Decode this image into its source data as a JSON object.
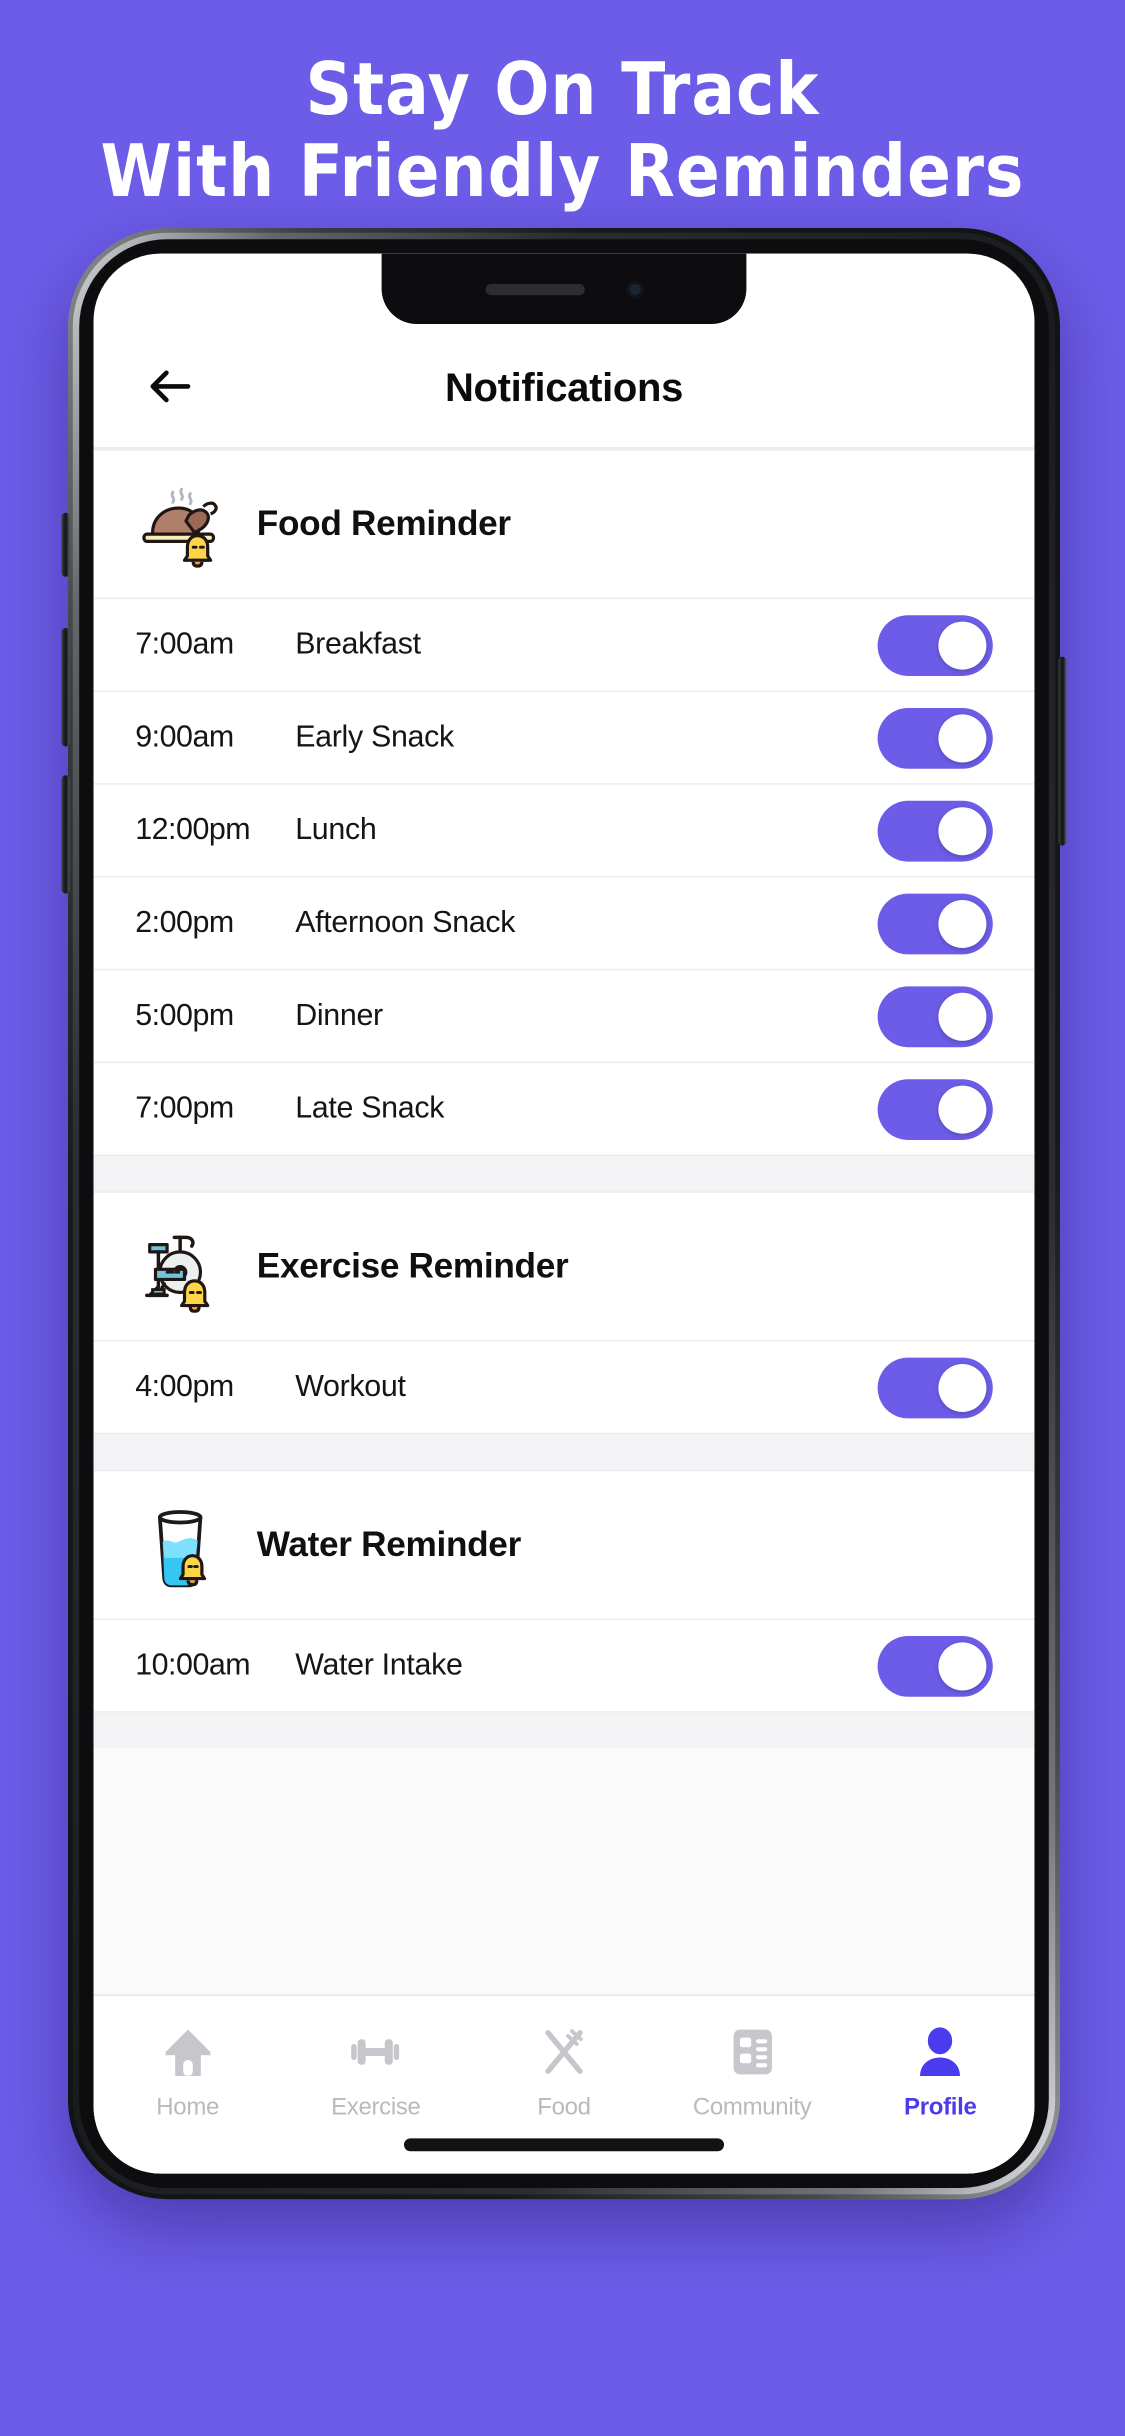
{
  "promo": {
    "headline_line1": "Stay On Track",
    "headline_line2": "With Friendly Reminders",
    "background_color": "#6C5CE7",
    "headline_color": "#FFFFFF"
  },
  "app": {
    "header": {
      "back_icon": "arrow-left-icon",
      "title": "Notifications"
    },
    "accent_color": "#6C5CE7",
    "active_tab_color": "#4B3BEF",
    "sections": [
      {
        "icon": "roast-meat-with-bell-icon",
        "title": "Food Reminder",
        "rows": [
          {
            "time": "7:00am",
            "label": "Breakfast",
            "enabled": true
          },
          {
            "time": "9:00am",
            "label": "Early Snack",
            "enabled": true
          },
          {
            "time": "12:00pm",
            "label": "Lunch",
            "enabled": true
          },
          {
            "time": "2:00pm",
            "label": "Afternoon Snack",
            "enabled": true
          },
          {
            "time": "5:00pm",
            "label": "Dinner",
            "enabled": true
          },
          {
            "time": "7:00pm",
            "label": "Late Snack",
            "enabled": true
          }
        ]
      },
      {
        "icon": "exercise-bike-with-bell-icon",
        "title": "Exercise Reminder",
        "rows": [
          {
            "time": "4:00pm",
            "label": "Workout",
            "enabled": true
          }
        ]
      },
      {
        "icon": "water-glass-with-bell-icon",
        "title": "Water Reminder",
        "rows": [
          {
            "time": "10:00am",
            "label": "Water Intake",
            "enabled": true
          }
        ]
      }
    ],
    "tabs": [
      {
        "icon": "home-icon",
        "label": "Home",
        "active": false
      },
      {
        "icon": "dumbbell-icon",
        "label": "Exercise",
        "active": false
      },
      {
        "icon": "cutlery-icon",
        "label": "Food",
        "active": false
      },
      {
        "icon": "community-icon",
        "label": "Community",
        "active": false
      },
      {
        "icon": "person-icon",
        "label": "Profile",
        "active": true
      }
    ]
  }
}
